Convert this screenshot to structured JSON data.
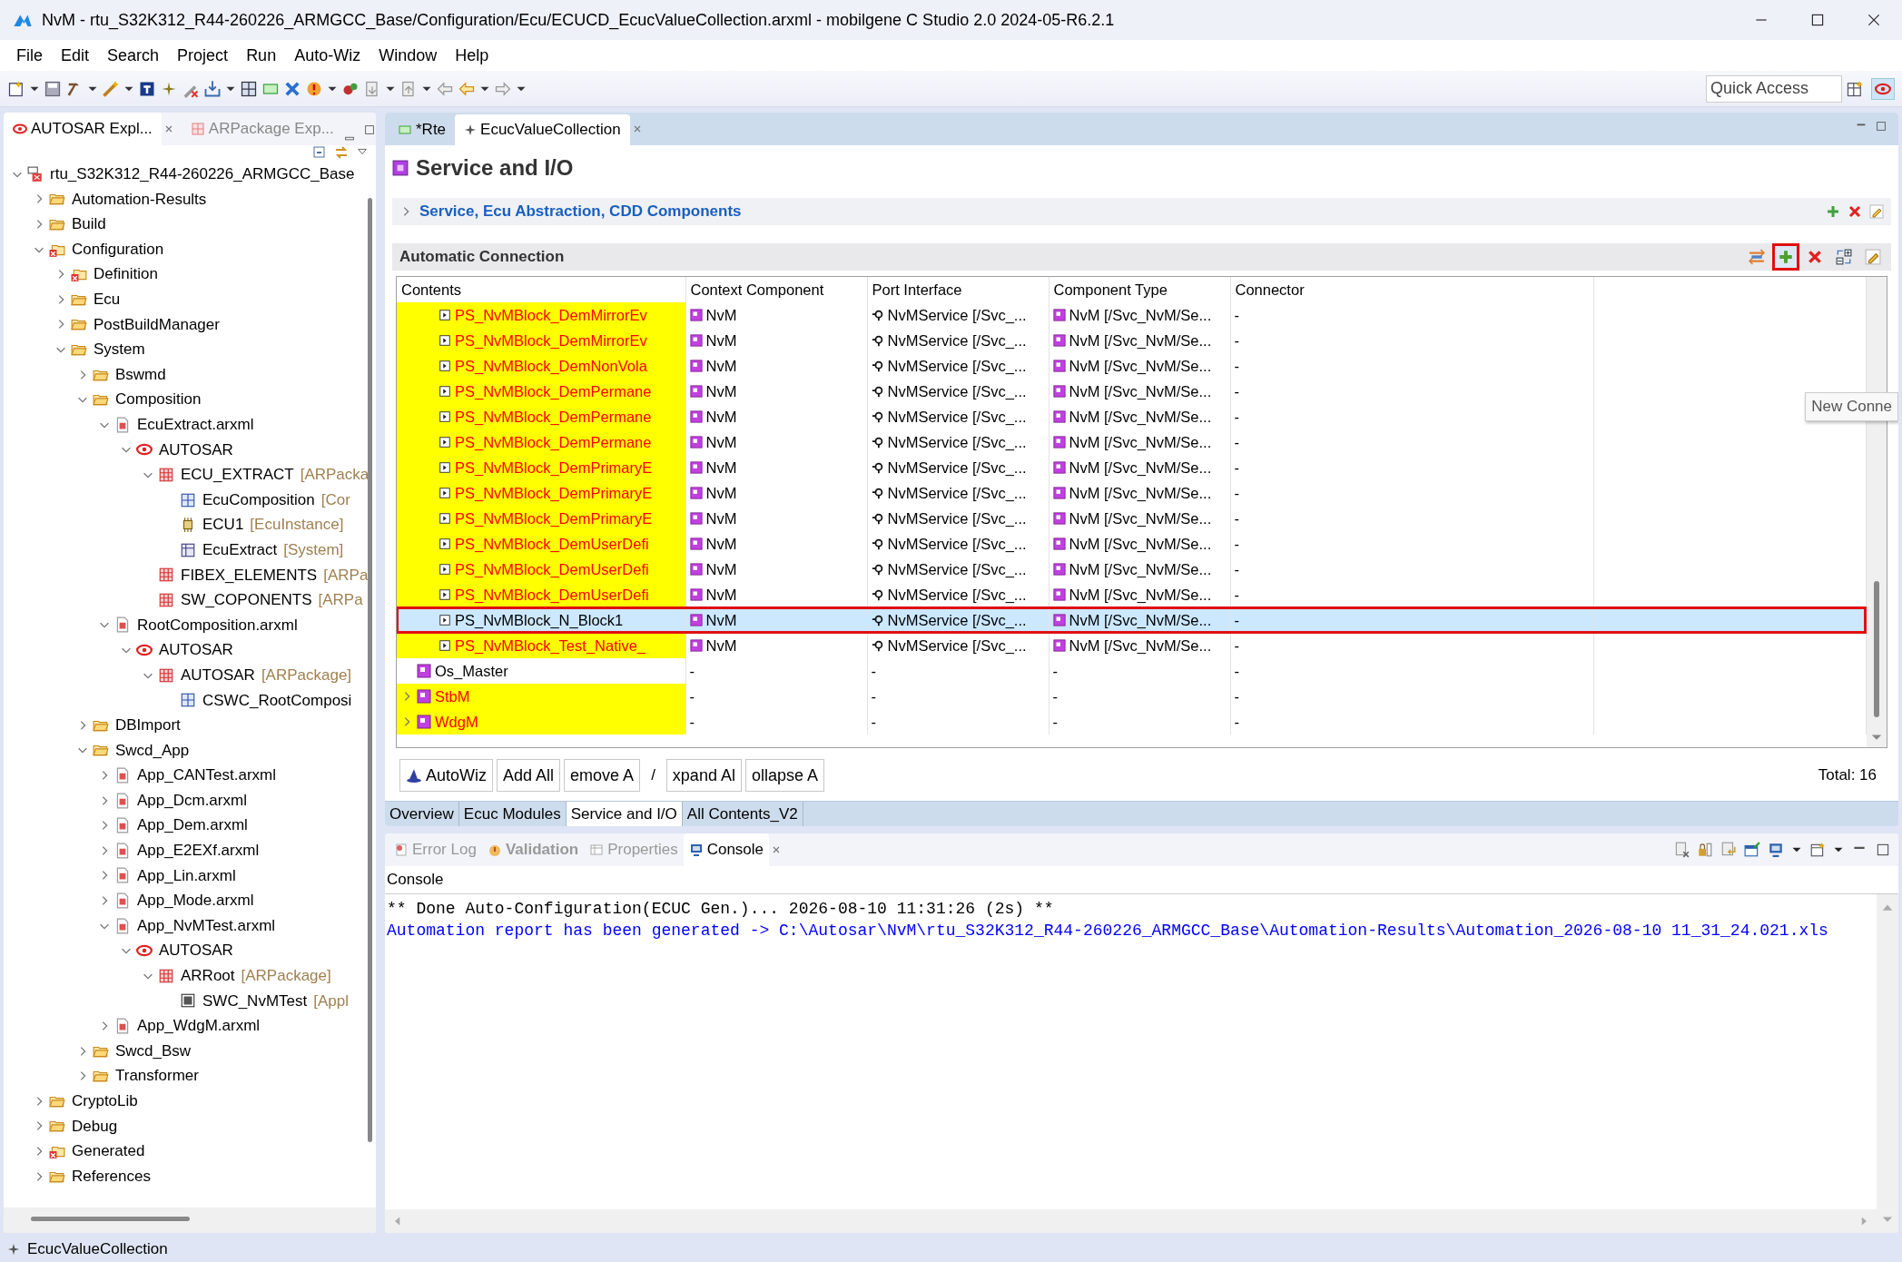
{
  "window": {
    "title": "NvM - rtu_S32K312_R44-260226_ARMGCC_Base/Configuration/Ecu/ECUCD_EcucValueCollection.arxml - mobilgene C Studio 2.0 2024-05-R6.2.1"
  },
  "menu": [
    "File",
    "Edit",
    "Search",
    "Project",
    "Run",
    "Auto-Wiz",
    "Window",
    "Help"
  ],
  "quick_access": {
    "placeholder": "Quick Access"
  },
  "left_panel": {
    "tabs": [
      {
        "label": "AUTOSAR Expl...",
        "selected": true,
        "closable": true
      },
      {
        "label": "ARPackage Exp...",
        "selected": false,
        "closable": false
      }
    ],
    "tree": [
      {
        "label": "rtu_S32K312_R44-260226_ARMGCC_Base",
        "kind": "project",
        "expanded": true,
        "children": [
          {
            "label": "Automation-Results",
            "kind": "folder",
            "expanded": false
          },
          {
            "label": "Build",
            "kind": "folder",
            "expanded": false
          },
          {
            "label": "Configuration",
            "kind": "config",
            "expanded": true,
            "children": [
              {
                "label": "Definition",
                "kind": "config",
                "expanded": false
              },
              {
                "label": "Ecu",
                "kind": "folder",
                "expanded": false
              },
              {
                "label": "PostBuildManager",
                "kind": "folder",
                "expanded": false
              },
              {
                "label": "System",
                "kind": "folder",
                "expanded": true,
                "children": [
                  {
                    "label": "Bswmd",
                    "kind": "folder",
                    "expanded": false
                  },
                  {
                    "label": "Composition",
                    "kind": "folder",
                    "expanded": true,
                    "children": [
                      {
                        "label": "EcuExtract.arxml",
                        "kind": "file",
                        "expanded": true,
                        "children": [
                          {
                            "label": "AUTOSAR",
                            "kind": "autosar",
                            "expanded": true,
                            "children": [
                              {
                                "label": "ECU_EXTRACT",
                                "suffix": "[ARPacka",
                                "kind": "package",
                                "expanded": true,
                                "children": [
                                  {
                                    "label": "EcuComposition",
                                    "suffix": "[Cor",
                                    "kind": "composition"
                                  },
                                  {
                                    "label": "ECU1",
                                    "suffix": "[EcuInstance]",
                                    "kind": "ecu"
                                  },
                                  {
                                    "label": "EcuExtract",
                                    "suffix": "[System]",
                                    "kind": "system"
                                  }
                                ]
                              },
                              {
                                "label": "FIBEX_ELEMENTS",
                                "suffix": "[ARPa",
                                "kind": "package"
                              },
                              {
                                "label": "SW_COPONENTS",
                                "suffix": "[ARPa",
                                "kind": "package"
                              }
                            ]
                          }
                        ]
                      },
                      {
                        "label": "RootComposition.arxml",
                        "kind": "file",
                        "expanded": true,
                        "children": [
                          {
                            "label": "AUTOSAR",
                            "kind": "autosar",
                            "expanded": true,
                            "children": [
                              {
                                "label": "AUTOSAR",
                                "suffix": "[ARPackage]",
                                "kind": "package",
                                "expanded": true,
                                "children": [
                                  {
                                    "label": "CSWC_RootComposi",
                                    "kind": "composition"
                                  }
                                ]
                              }
                            ]
                          }
                        ]
                      }
                    ]
                  },
                  {
                    "label": "DBImport",
                    "kind": "folder",
                    "expanded": false
                  },
                  {
                    "label": "Swcd_App",
                    "kind": "folder",
                    "expanded": true,
                    "children": [
                      {
                        "label": "App_CANTest.arxml",
                        "kind": "file",
                        "expanded": false
                      },
                      {
                        "label": "App_Dcm.arxml",
                        "kind": "file",
                        "expanded": false
                      },
                      {
                        "label": "App_Dem.arxml",
                        "kind": "file",
                        "expanded": false
                      },
                      {
                        "label": "App_E2EXf.arxml",
                        "kind": "file",
                        "expanded": false
                      },
                      {
                        "label": "App_Lin.arxml",
                        "kind": "file",
                        "expanded": false
                      },
                      {
                        "label": "App_Mode.arxml",
                        "kind": "file",
                        "expanded": false
                      },
                      {
                        "label": "App_NvMTest.arxml",
                        "kind": "file",
                        "expanded": true,
                        "children": [
                          {
                            "label": "AUTOSAR",
                            "kind": "autosar",
                            "expanded": true,
                            "children": [
                              {
                                "label": "ARRoot",
                                "suffix": "[ARPackage]",
                                "kind": "package",
                                "expanded": true,
                                "children": [
                                  {
                                    "label": "SWC_NvMTest",
                                    "suffix": "[Appl",
                                    "kind": "swc"
                                  }
                                ]
                              }
                            ]
                          }
                        ]
                      },
                      {
                        "label": "App_WdgM.arxml",
                        "kind": "file",
                        "expanded": false
                      }
                    ]
                  },
                  {
                    "label": "Swcd_Bsw",
                    "kind": "folder",
                    "expanded": false
                  },
                  {
                    "label": "Transformer",
                    "kind": "folder",
                    "expanded": false
                  }
                ]
              }
            ]
          },
          {
            "label": "CryptoLib",
            "kind": "folder",
            "expanded": false
          },
          {
            "label": "Debug",
            "kind": "folder",
            "expanded": false
          },
          {
            "label": "Generated",
            "kind": "config",
            "expanded": false
          },
          {
            "label": "References",
            "kind": "folder",
            "expanded": false
          }
        ]
      }
    ]
  },
  "editor": {
    "tabs": [
      {
        "label": "*Rte",
        "selected": false,
        "closable": false
      },
      {
        "label": "EcucValueCollection",
        "selected": true,
        "closable": true
      }
    ],
    "page_title": "Service and I/O",
    "sections": [
      {
        "title": "Service, Ecu Abstraction, CDD Components",
        "expanded": false
      }
    ],
    "automatic_connection": {
      "title": "Automatic Connection",
      "tools": [
        {
          "kind": "connections",
          "outlined": false
        },
        {
          "kind": "add",
          "outlined": true
        },
        {
          "kind": "remove",
          "outlined": false
        },
        {
          "kind": "expand",
          "outlined": false
        },
        {
          "kind": "edit",
          "outlined": false
        }
      ],
      "tooltip": "New Conne",
      "table": {
        "columns": [
          "Contents",
          "Context Component",
          "Port Interface",
          "Component Type",
          "Connector"
        ],
        "rows": [
          {
            "kind": "port",
            "highlighted": true,
            "selected": false,
            "outlined": false,
            "cells": [
              "PS_NvMBlock_DemMirrorEv",
              "NvM",
              "NvMService [/Svc_...",
              "NvM [/Svc_NvM/Se...",
              "-"
            ]
          },
          {
            "kind": "port",
            "highlighted": true,
            "selected": false,
            "outlined": false,
            "cells": [
              "PS_NvMBlock_DemMirrorEv",
              "NvM",
              "NvMService [/Svc_...",
              "NvM [/Svc_NvM/Se...",
              "-"
            ]
          },
          {
            "kind": "port",
            "highlighted": true,
            "selected": false,
            "outlined": false,
            "cells": [
              "PS_NvMBlock_DemNonVola",
              "NvM",
              "NvMService [/Svc_...",
              "NvM [/Svc_NvM/Se...",
              "-"
            ]
          },
          {
            "kind": "port",
            "highlighted": true,
            "selected": false,
            "outlined": false,
            "cells": [
              "PS_NvMBlock_DemPermane",
              "NvM",
              "NvMService [/Svc_...",
              "NvM [/Svc_NvM/Se...",
              "-"
            ]
          },
          {
            "kind": "port",
            "highlighted": true,
            "selected": false,
            "outlined": false,
            "cells": [
              "PS_NvMBlock_DemPermane",
              "NvM",
              "NvMService [/Svc_...",
              "NvM [/Svc_NvM/Se...",
              "-"
            ]
          },
          {
            "kind": "port",
            "highlighted": true,
            "selected": false,
            "outlined": false,
            "cells": [
              "PS_NvMBlock_DemPermane",
              "NvM",
              "NvMService [/Svc_...",
              "NvM [/Svc_NvM/Se...",
              "-"
            ]
          },
          {
            "kind": "port",
            "highlighted": true,
            "selected": false,
            "outlined": false,
            "cells": [
              "PS_NvMBlock_DemPrimaryE",
              "NvM",
              "NvMService [/Svc_...",
              "NvM [/Svc_NvM/Se...",
              "-"
            ]
          },
          {
            "kind": "port",
            "highlighted": true,
            "selected": false,
            "outlined": false,
            "cells": [
              "PS_NvMBlock_DemPrimaryE",
              "NvM",
              "NvMService [/Svc_...",
              "NvM [/Svc_NvM/Se...",
              "-"
            ]
          },
          {
            "kind": "port",
            "highlighted": true,
            "selected": false,
            "outlined": false,
            "cells": [
              "PS_NvMBlock_DemPrimaryE",
              "NvM",
              "NvMService [/Svc_...",
              "NvM [/Svc_NvM/Se...",
              "-"
            ]
          },
          {
            "kind": "port",
            "highlighted": true,
            "selected": false,
            "outlined": false,
            "cells": [
              "PS_NvMBlock_DemUserDefi",
              "NvM",
              "NvMService [/Svc_...",
              "NvM [/Svc_NvM/Se...",
              "-"
            ]
          },
          {
            "kind": "port",
            "highlighted": true,
            "selected": false,
            "outlined": false,
            "cells": [
              "PS_NvMBlock_DemUserDefi",
              "NvM",
              "NvMService [/Svc_...",
              "NvM [/Svc_NvM/Se...",
              "-"
            ]
          },
          {
            "kind": "port",
            "highlighted": true,
            "selected": false,
            "outlined": false,
            "cells": [
              "PS_NvMBlock_DemUserDefi",
              "NvM",
              "NvMService [/Svc_...",
              "NvM [/Svc_NvM/Se...",
              "-"
            ]
          },
          {
            "kind": "port",
            "highlighted": false,
            "selected": true,
            "outlined": true,
            "cells": [
              "PS_NvMBlock_N_Block1",
              "NvM",
              "NvMService [/Svc_...",
              "NvM [/Svc_NvM/Se...",
              "-"
            ]
          },
          {
            "kind": "port",
            "highlighted": true,
            "selected": false,
            "outlined": false,
            "cells": [
              "PS_NvMBlock_Test_Native_",
              "NvM",
              "NvMService [/Svc_...",
              "NvM [/Svc_NvM/Se...",
              "-"
            ]
          },
          {
            "kind": "leaf",
            "highlighted": false,
            "selected": false,
            "outlined": false,
            "cells": [
              "Os_Master",
              "-",
              "-",
              "-",
              "-"
            ]
          },
          {
            "kind": "component",
            "highlighted": true,
            "selected": false,
            "outlined": false,
            "expanded": false,
            "cells": [
              "StbM",
              "-",
              "-",
              "-",
              "-"
            ]
          },
          {
            "kind": "component",
            "highlighted": true,
            "selected": false,
            "outlined": false,
            "expanded": false,
            "cells": [
              "WdgM",
              "-",
              "-",
              "-",
              "-"
            ]
          }
        ]
      }
    },
    "buttons": [
      {
        "kind": "wizard",
        "label": "AutoWiz"
      },
      {
        "kind": "button",
        "label": "Add All"
      },
      {
        "kind": "button",
        "label": "emove A"
      },
      {
        "kind": "text",
        "label": "/"
      },
      {
        "kind": "button",
        "label": "xpand Al"
      },
      {
        "kind": "button",
        "label": "ollapse A"
      }
    ],
    "total": "Total: 16",
    "page_tabs": [
      {
        "label": "Overview",
        "selected": false
      },
      {
        "label": "Ecuc Modules",
        "selected": false
      },
      {
        "label": "Service and I/O",
        "selected": true
      },
      {
        "label": "All Contents_V2",
        "selected": false
      }
    ]
  },
  "console_view": {
    "tabs": [
      {
        "label": "Error Log",
        "selected": false,
        "highlighted": false,
        "closable": false
      },
      {
        "label": "Validation",
        "selected": false,
        "highlighted": true,
        "closable": false
      },
      {
        "label": "Properties",
        "selected": false,
        "highlighted": false,
        "closable": false
      },
      {
        "label": "Console",
        "selected": true,
        "highlighted": false,
        "closable": true
      }
    ],
    "title": "Console",
    "lines": [
      {
        "kind": "plain",
        "text": "** Done Auto-Configuration(ECUC Gen.)... 2026-08-10 11:31:26 (2s) **"
      },
      {
        "kind": "link",
        "text": "Automation report has been generated -> C:\\Autosar\\NvM\\rtu_S32K312_R44-260226_ARMGCC_Base\\Automation-Results\\Automation_2026-08-10 11_31_24.021.xls"
      }
    ]
  },
  "status_bar": {
    "text": "EcucValueCollection"
  }
}
